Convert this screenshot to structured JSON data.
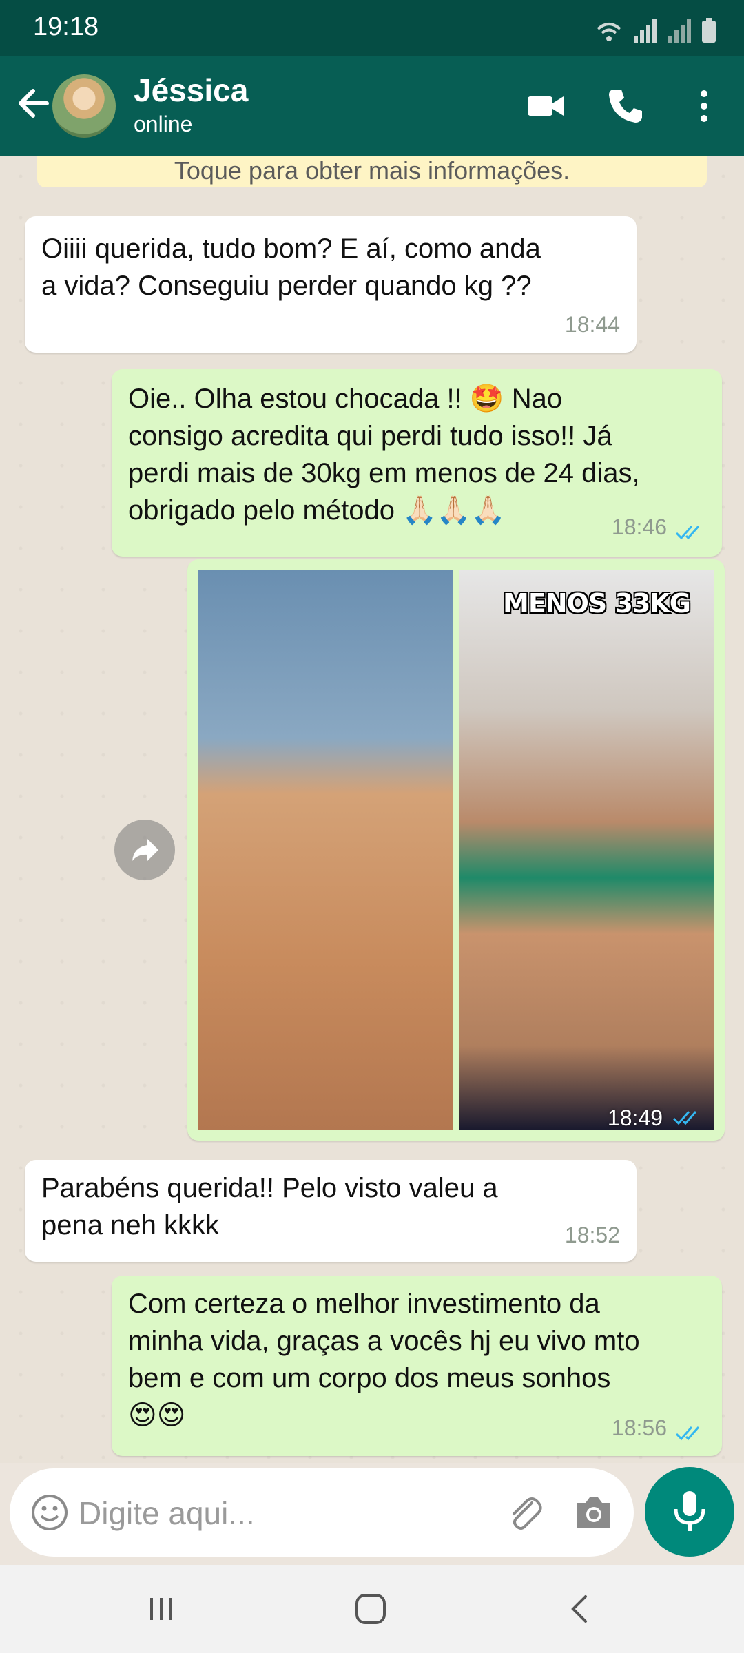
{
  "status": {
    "time": "19:18"
  },
  "header": {
    "name": "Jéssica",
    "presence": "online"
  },
  "banner": {
    "text": "Toque para obter mais informações."
  },
  "messages": [
    {
      "dir": "in",
      "text": "Oiiii querida, tudo bom? E aí, como anda\na vida? Conseguiu perder quando kg ??",
      "time": "18:44"
    },
    {
      "dir": "out",
      "text": "Oie.. Olha estou chocada !! 🤩 Nao\nconsigo acredita qui perdi tudo isso!! Já\nperdi mais de 30kg em menos de 24 dias,\nobrigado pelo método 🙏🏻🙏🏻🙏🏻",
      "time": "18:46"
    },
    {
      "dir": "out",
      "type": "image",
      "label": "MENOS 33KG",
      "time": "18:49"
    },
    {
      "dir": "in",
      "text": "Parabéns querida!! Pelo visto valeu a\npena neh kkkk",
      "time": "18:52"
    },
    {
      "dir": "out",
      "text": "Com certeza o melhor investimento da\nminha vida, graças a vocês hj eu vivo mto\nbem e com um corpo dos meus sonhos\n😍😍",
      "time": "18:56"
    }
  ],
  "composer": {
    "placeholder": "Digite aqui..."
  },
  "colors": {
    "header": "#075e54",
    "statusbar": "#054d44",
    "out_bubble": "#dcf8c6",
    "in_bubble": "#ffffff",
    "mic": "#00897b",
    "read_ticks": "#34b7f1"
  }
}
